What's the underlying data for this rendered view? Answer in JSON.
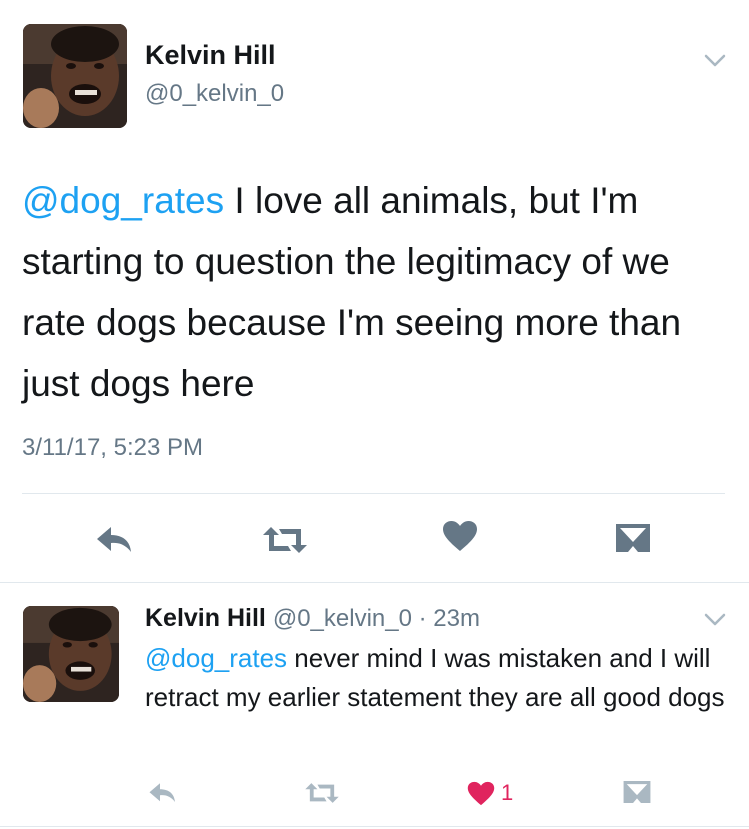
{
  "main_tweet": {
    "author_name": "Kelvin Hill",
    "author_handle": "@0_kelvin_0",
    "mention": "@dog_rates",
    "text": " I love all animals, but I'm starting to question the legitimacy of we rate dogs because I'm seeing more than just dogs here",
    "timestamp": "3/11/17, 5:23 PM",
    "icons": [
      "chevron-down-icon",
      "reply-icon",
      "retweet-icon",
      "heart-icon",
      "message-icon"
    ]
  },
  "reply_tweet": {
    "author_name": "Kelvin Hill",
    "author_handle": "@0_kelvin_0",
    "separator": "·",
    "age": "23m",
    "mention": "@dog_rates",
    "text": " never mind I was mistaken and I will retract my earlier statement they are all good dogs",
    "like_count": "1",
    "icons": [
      "chevron-down-icon",
      "reply-icon",
      "retweet-icon",
      "heart-icon",
      "message-icon"
    ]
  },
  "colors": {
    "mention": "#1da1f2",
    "text": "#14171a",
    "secondary": "#657786",
    "action_icon": "#657786",
    "liked": "#e0245e",
    "divider": "#e1e8ed"
  }
}
